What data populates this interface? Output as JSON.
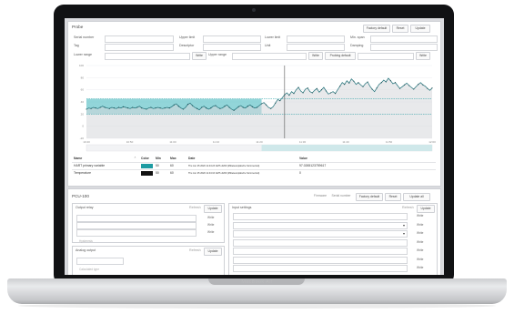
{
  "device": {
    "model_label": "MacBook Air"
  },
  "probe": {
    "title": "Probe",
    "buttons": {
      "factory_default": "Factory default",
      "reset": "Reset",
      "update": "Update"
    },
    "fields": [
      {
        "label": "Serial number",
        "placeholder": ""
      },
      {
        "label": "Upper limit",
        "placeholder": ""
      },
      {
        "label": "Lower limit",
        "placeholder": ""
      },
      {
        "label": "Min. span",
        "placeholder": ""
      },
      {
        "label": "Tag",
        "placeholder": ""
      },
      {
        "label": "Descriptor",
        "placeholder": ""
      },
      {
        "label": "Unit",
        "placeholder": ""
      },
      {
        "label": "Damping",
        "placeholder": ""
      }
    ],
    "range_row": {
      "lower_label": "Lower range",
      "lower_write": "Write",
      "upper_label": "Upper range",
      "upper_write": "Write",
      "probe_default": "Probing default",
      "final_write": "Write"
    },
    "chart_ticks_y": [
      "100",
      "80",
      "60",
      "40",
      "20",
      "0",
      "-20"
    ],
    "chart_ticks_x": [
      "10:40",
      "10:50",
      "11:00",
      "11:10",
      "11:20",
      "11:30",
      "11:40",
      "11:50",
      "12:00"
    ],
    "table": {
      "headers": [
        "Name",
        "Color",
        "Min",
        "Max",
        "Date",
        "Value"
      ],
      "rows": [
        {
          "name": "HART primary variable",
          "color": "#1d9ba2",
          "min": "50",
          "max": "60",
          "date": "Thu Jun 25 2020 11:44:23 GMT+0200 (Mitteleuropäische Sommerzeit)",
          "value": "97.0265123759617"
        },
        {
          "name": "Temperature",
          "color": "#111111",
          "min": "50",
          "max": "60",
          "date": "Thu Jun 25 2020 11:44:16 GMT+0200 (Mitteleuropäische Sommerzeit)",
          "value": "0"
        }
      ]
    }
  },
  "pcu": {
    "title": "PCU-100",
    "buttons": {
      "firmware": "Firmware",
      "serial": "Serial number",
      "factory_default": "Factory default",
      "reset": "Reset",
      "update_all": "Update all"
    },
    "output_relay": {
      "title": "Output relay",
      "refresh": "Refresh",
      "update": "Update",
      "items": [
        {
          "label": "Output mode",
          "write": "Write"
        },
        {
          "label": "Setpoint",
          "write": "Write"
        },
        {
          "label": "Hysteresis",
          "write": "Write"
        }
      ]
    },
    "input_settings": {
      "title": "Input settings",
      "refresh": "Refresh",
      "update": "Update",
      "items": [
        {
          "label": "Sensor address",
          "write": "Write"
        },
        {
          "label": "Input type",
          "write": "Write"
        },
        {
          "label": "Sensor type",
          "write": "Write"
        },
        {
          "label": "Minimum range",
          "write": "Write"
        },
        {
          "label": "Maximum range",
          "write": "Write"
        },
        {
          "label": "Extended minimum range",
          "write": "Write"
        },
        {
          "label": "Extended maximum range",
          "write": "Write"
        }
      ]
    },
    "analog_output": {
      "title": "Analog output",
      "refresh": "Refresh",
      "update": "Update",
      "field": "Calculated type"
    }
  },
  "chart_data": {
    "type": "line",
    "series": [
      {
        "values": [
          28,
          30,
          29,
          31,
          30,
          29,
          31,
          33,
          31,
          30,
          29,
          31,
          30,
          29,
          31,
          30,
          32,
          31,
          30,
          29,
          31,
          30,
          31,
          33,
          30,
          29,
          28,
          30,
          31,
          29,
          30,
          31,
          30,
          29,
          30,
          31,
          30,
          32,
          35,
          37,
          33,
          30,
          28,
          31,
          36,
          38,
          34,
          31,
          29,
          27,
          31,
          33,
          30,
          28,
          30,
          33,
          34,
          31,
          29,
          30,
          33,
          35,
          31,
          28,
          26,
          29,
          32,
          34,
          31,
          30,
          33,
          35,
          32,
          30,
          31,
          34,
          37,
          39,
          35,
          31,
          29,
          32,
          38,
          44,
          42,
          47,
          52,
          55,
          51,
          57,
          54,
          60,
          64,
          58,
          55,
          61,
          63,
          57,
          55,
          59,
          62,
          56,
          60,
          64,
          58,
          53,
          55,
          57,
          54,
          60,
          66,
          72,
          69,
          75,
          71,
          78,
          74,
          69,
          72,
          68,
          65,
          70,
          73,
          66,
          61,
          57,
          63,
          69,
          72,
          76,
          73,
          79,
          75,
          70,
          72,
          67,
          62,
          65,
          68,
          71,
          67,
          64,
          61,
          65,
          69,
          72,
          68,
          66,
          62,
          59,
          63
        ]
      }
    ],
    "ylim": [
      -20,
      100
    ]
  }
}
